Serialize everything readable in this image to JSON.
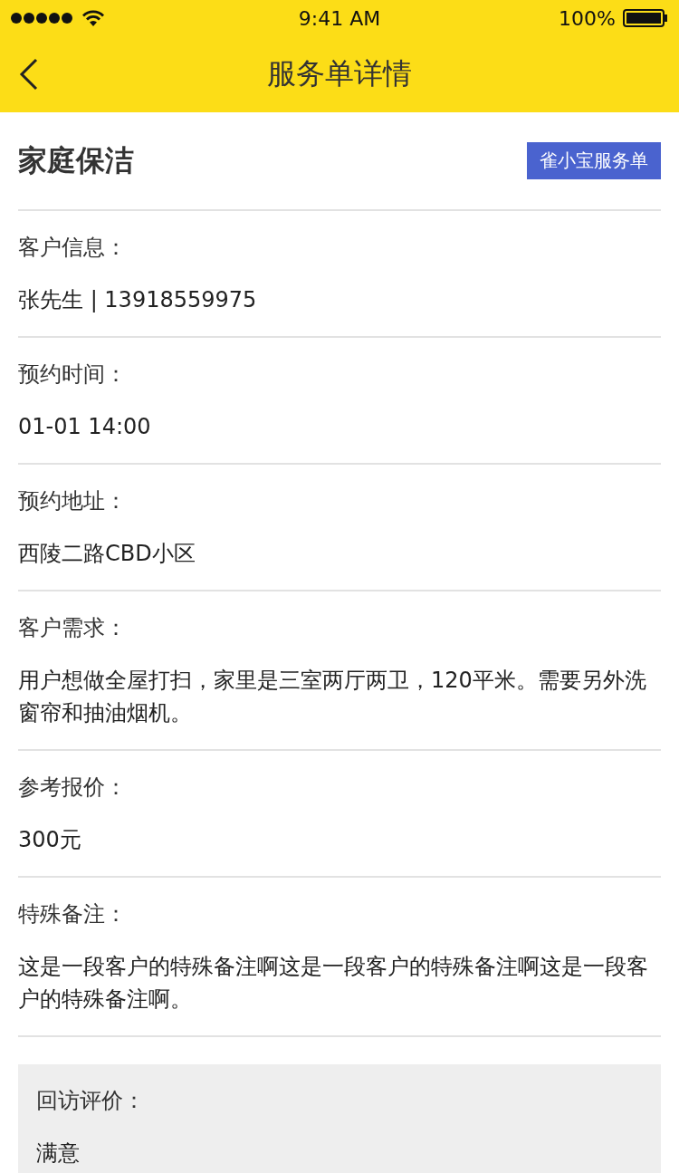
{
  "status_bar": {
    "time": "9:41 AM",
    "battery": "100%"
  },
  "nav": {
    "title": "服务单详情"
  },
  "header": {
    "title": "家庭保洁",
    "badge": "雀小宝服务单"
  },
  "sections": [
    {
      "label": "客户信息：",
      "value": "张先生 | 13918559975"
    },
    {
      "label": "预约时间：",
      "value": "01-01 14:00"
    },
    {
      "label": "预约地址：",
      "value": "西陵二路CBD小区"
    },
    {
      "label": "客户需求：",
      "value": "用户想做全屋打扫，家里是三室两厅两卫，120平米。需要另外洗窗帘和抽油烟机。"
    },
    {
      "label": "参考报价：",
      "value": "300元"
    },
    {
      "label": "特殊备注：",
      "value": "这是一段客户的特殊备注啊这是一段客户的特殊备注啊这是一段客户的特殊备注啊。"
    }
  ],
  "feedback": {
    "label": "回访评价：",
    "value": "满意"
  }
}
